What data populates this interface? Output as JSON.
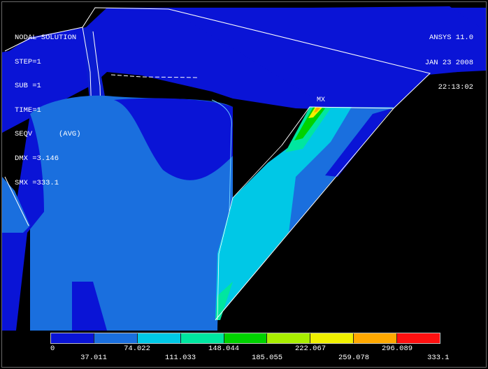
{
  "header_left": {
    "title": "NODAL SOLUTION",
    "lines": [
      "STEP=1",
      "SUB =1",
      "TIME=1",
      "SEQV      (AVG)",
      "DMX =3.146",
      "SMX =333.1"
    ]
  },
  "header_right": {
    "version": "ANSYS 11.0",
    "date": "JAN 23 2008",
    "time": "22:13:02"
  },
  "marker": "MX",
  "legend": {
    "colors": [
      "#0a14d6",
      "#1a6fde",
      "#00c8e6",
      "#00e6a0",
      "#00d200",
      "#a8ee00",
      "#f0f000",
      "#ffa800",
      "#ff1010"
    ],
    "labels_top": [
      "0",
      "74.022",
      "148.044",
      "222.067",
      "296.089"
    ],
    "labels_bottom": [
      "37.011",
      "111.033",
      "185.055",
      "259.078",
      "333.1"
    ]
  }
}
